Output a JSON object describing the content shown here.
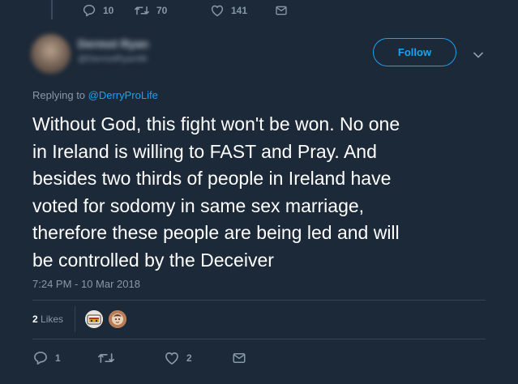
{
  "top_actions": {
    "replies": "10",
    "retweets": "70",
    "likes": "141"
  },
  "author": {
    "display_name": "Dermot Ryan",
    "handle": "@DermotRyan98"
  },
  "follow_label": "Follow",
  "reply_prefix": "Replying to ",
  "reply_handle": "@DerryProLife",
  "tweet_text": "Without God, this fight won't be won. No one\nin Ireland is willing to FAST and Pray. And\nbesides two thirds of people in Ireland have\nvoted for sodomy in same sex marriage,\ntherefore these people are being led and will\nbe controlled by the Deceiver",
  "timestamp": "7:24 PM - 10 Mar 2018",
  "likes_count": "2",
  "likes_label": " Likes",
  "bottom_actions": {
    "replies": "1",
    "retweets": "",
    "likes": "2"
  },
  "colors": {
    "background": "#1c2938",
    "accent": "#1da1f2",
    "muted": "#8899a6",
    "divider": "#38444d"
  },
  "icons": {
    "reply": "reply-icon",
    "retweet": "retweet-icon",
    "like": "heart-icon",
    "message": "envelope-icon",
    "menu": "chevron-down-icon"
  }
}
